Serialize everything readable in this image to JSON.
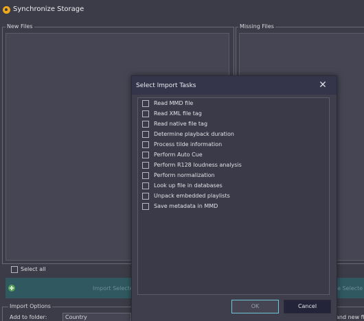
{
  "window": {
    "title": "Synchronize Storage",
    "icon": "app-logo-icon"
  },
  "new_files": {
    "label": "New Files"
  },
  "missing_files": {
    "label": "Missing Files"
  },
  "select_all": {
    "label": "Select all",
    "checked": false
  },
  "import_bar": {
    "left_label": "Import Selecte",
    "right_label": "te Selecte"
  },
  "import_options": {
    "label": "Import Options",
    "add_to_folder_label": "Add to folder:",
    "folder_value": "Country",
    "right_fragment": "and new fi"
  },
  "dialog": {
    "title": "Select Import Tasks",
    "tasks": [
      {
        "label": "Read MMD file",
        "checked": false
      },
      {
        "label": "Read XML file tag",
        "checked": false
      },
      {
        "label": "Read native file tag",
        "checked": false
      },
      {
        "label": "Determine playback duration",
        "checked": false
      },
      {
        "label": "Process tilde information",
        "checked": false
      },
      {
        "label": "Perform Auto Cue",
        "checked": false
      },
      {
        "label": "Perform R128 loudness analysis",
        "checked": false
      },
      {
        "label": "Perform normalization",
        "checked": false
      },
      {
        "label": "Look up file in databases",
        "checked": false
      },
      {
        "label": "Unpack embedded playlists",
        "checked": false
      },
      {
        "label": "Save metadata in MMD",
        "checked": false
      }
    ],
    "ok_label": "OK",
    "cancel_label": "Cancel"
  },
  "colors": {
    "background": "#3c3c48",
    "import_bar": "#2f5860",
    "ok_border": "#6ec6d6",
    "cancel_bg": "#23233a",
    "app_icon": "#f2a81d"
  }
}
